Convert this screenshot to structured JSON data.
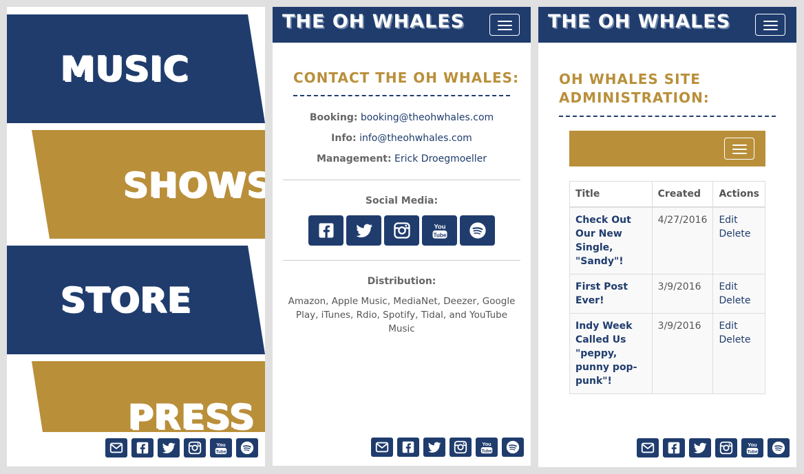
{
  "menu": {
    "music_label": "Music",
    "shows_label": "Shows",
    "store_label": "Store",
    "press_label": "Press"
  },
  "brand": {
    "title": "The Oh Whales"
  },
  "colors": {
    "navy": "#1f3c6d",
    "gold": "#b98f3a"
  },
  "footer_icons": [
    "envelope-icon",
    "facebook-icon",
    "twitter-icon",
    "instagram-icon",
    "youtube-icon",
    "spotify-icon"
  ],
  "contact": {
    "heading": "Contact The Oh Whales:",
    "booking_label": "Booking:",
    "booking_email": "booking@theohwhales.com",
    "info_label": "Info:",
    "info_email": "info@theohwhales.com",
    "management_label": "Management:",
    "management_name": "Erick Droegmoeller",
    "social_label": "Social Media:",
    "social_icons": [
      "facebook-icon",
      "twitter-icon",
      "instagram-icon",
      "youtube-icon",
      "spotify-icon"
    ],
    "distribution_label": "Distribution:",
    "distribution_text": "Amazon, Apple Music, MediaNet, Deezer, Google Play, iTunes, Rdio, Spotify, Tidal, and YouTube Music"
  },
  "admin": {
    "heading": "Oh Whales Site Administration:",
    "columns": [
      "Title",
      "Created",
      "Actions"
    ],
    "rows": [
      {
        "title": "Check Out Our New Single, \"Sandy\"!",
        "created": "4/27/2016",
        "edit": "Edit",
        "delete": "Delete"
      },
      {
        "title": "First Post Ever!",
        "created": "3/9/2016",
        "edit": "Edit",
        "delete": "Delete"
      },
      {
        "title": "Indy Week Called Us \"peppy, punny pop-punk\"!",
        "created": "3/9/2016",
        "edit": "Edit",
        "delete": "Delete"
      }
    ]
  }
}
